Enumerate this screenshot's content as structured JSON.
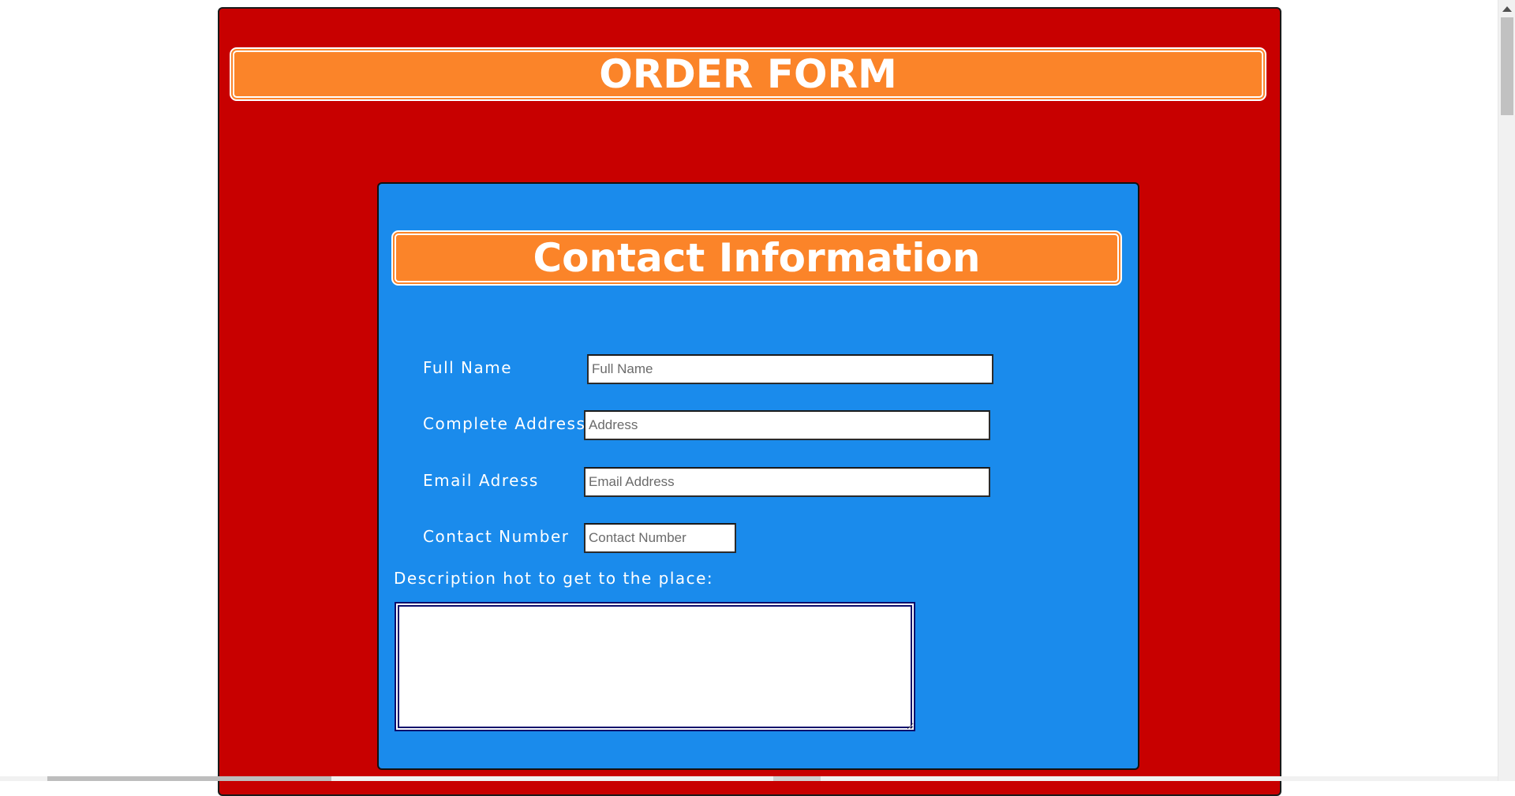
{
  "order_form": {
    "title": "ORDER FORM"
  },
  "contact_section": {
    "title": "Contact Information",
    "fields": [
      {
        "label": "Full Name",
        "placeholder": "Full Name",
        "value": ""
      },
      {
        "label": "Complete Address",
        "placeholder": "Address",
        "value": ""
      },
      {
        "label": "Email Adress",
        "placeholder": "Email Address",
        "value": ""
      },
      {
        "label": "Contact Number",
        "placeholder": "Contact Number",
        "value": ""
      }
    ],
    "description_label": "Description hot to get to the place:",
    "description_value": ""
  },
  "colors": {
    "outer_background": "#c80000",
    "inner_background": "#1a8bec",
    "banner_background": "#fb8429",
    "text": "#ffffff"
  }
}
